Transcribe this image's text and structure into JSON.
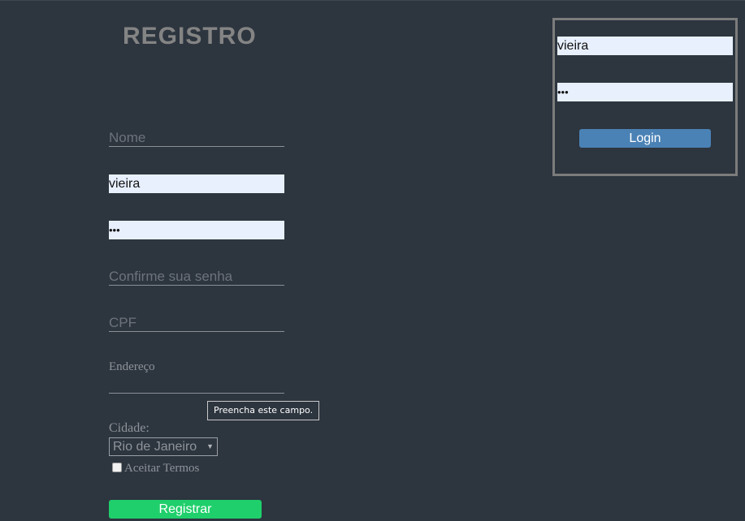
{
  "register": {
    "title": "REGISTRO",
    "nome_placeholder": "Nome",
    "username_value": "vieira",
    "password_value": "•••",
    "confirm_placeholder": "Confirme sua senha",
    "cpf_placeholder": "CPF",
    "endereco_placeholder": "Endereço",
    "tooltip": "Preencha este campo.",
    "cidade_label": "Cidade:",
    "cidade_selected": "Rio de Janeiro",
    "select_arrow_icon": "▼",
    "terms_label": "Aceitar Termos",
    "terms_checked": false,
    "submit_label": "Registrar"
  },
  "login": {
    "username_value": "vieira",
    "password_value": "•••",
    "submit_label": "Login"
  },
  "colors": {
    "background": "#2d353f",
    "register_button": "#1fcf6b",
    "login_button": "#4a82b5",
    "autofill": "#e8f0fe"
  }
}
